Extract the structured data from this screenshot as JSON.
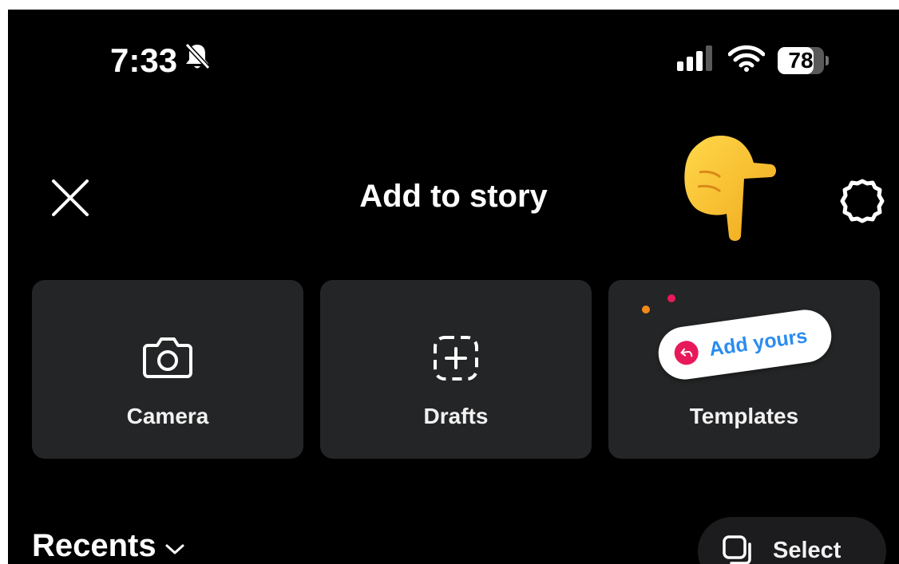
{
  "status_bar": {
    "time": "7:33",
    "battery_percent": "78",
    "battery_level": 0.78,
    "icons": [
      "bell-slash-icon",
      "cellular-signal-icon",
      "wifi-icon",
      "battery-icon"
    ]
  },
  "header": {
    "title": "Add to story",
    "close_icon": "close-icon",
    "settings_icon": "gear-icon",
    "decoration": "pointing-hand-emoji"
  },
  "tiles": [
    {
      "label": "Camera",
      "icon": "camera-icon"
    },
    {
      "label": "Drafts",
      "icon": "dashed-plus-square-icon"
    },
    {
      "label": "Templates",
      "sticker_text": "Add yours",
      "icon": "add-yours-sticker"
    }
  ],
  "gallery": {
    "recents_label": "Recents",
    "select_label": "Select"
  },
  "colors": {
    "background": "#000000",
    "tile": "#242526",
    "sticker_text": "#2a8cf0",
    "sticker_badge": "#e8195a",
    "dot_orange": "#f28a1c",
    "dot_pink": "#e8195a"
  }
}
